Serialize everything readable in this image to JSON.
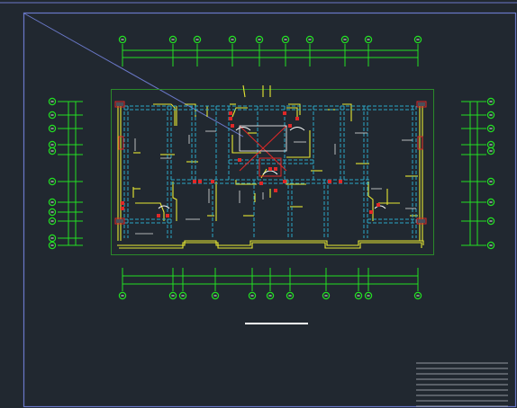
{
  "app": {
    "view": "cad-model-space",
    "background": "#212830"
  },
  "colors": {
    "frame": "#6a78c8",
    "axis_green": "#22e022",
    "wall_yellow": "#e8e832",
    "column_cyan": "#2aa8c8",
    "opening_red": "#e02828",
    "text_white": "#ffffff",
    "outline_green": "#2a8a2a",
    "title_block": "#b8bcc4"
  },
  "drawing": {
    "grid_bubbles": {
      "top_count": 11,
      "bottom_count": 11,
      "left_count": 10,
      "right_count": 10,
      "bubble_icon": "circle-axis-bubble-icon"
    },
    "title_block_lines": 9
  }
}
